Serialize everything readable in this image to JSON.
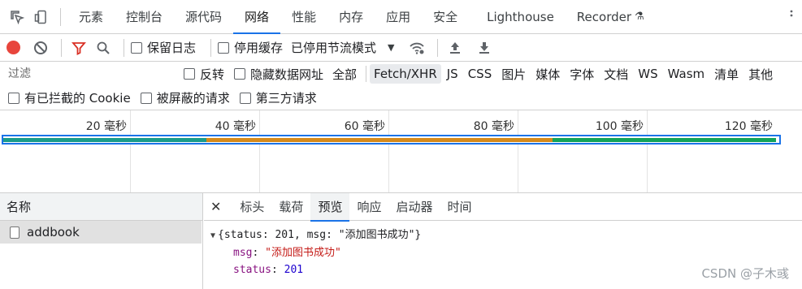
{
  "top_tabs": [
    {
      "label": "元素",
      "active": false
    },
    {
      "label": "控制台",
      "active": false
    },
    {
      "label": "源代码",
      "active": false
    },
    {
      "label": "网络",
      "active": true
    },
    {
      "label": "性能",
      "active": false
    },
    {
      "label": "内存",
      "active": false
    },
    {
      "label": "应用",
      "active": false
    },
    {
      "label": "安全",
      "active": false
    },
    {
      "label": "Lighthouse",
      "active": false
    },
    {
      "label": "Recorder",
      "active": false
    }
  ],
  "toolbar": {
    "preserve_log": "保留日志",
    "disable_cache": "停用缓存",
    "throttle": "已停用节流模式"
  },
  "filter": {
    "placeholder": "过滤",
    "invert": "反转",
    "hide_data_urls": "隐藏数据网址",
    "types": [
      "全部",
      "Fetch/XHR",
      "JS",
      "CSS",
      "图片",
      "媒体",
      "字体",
      "文档",
      "WS",
      "Wasm",
      "清单",
      "其他"
    ],
    "active_type": "Fetch/XHR",
    "blocked_cookies": "有已拦截的 Cookie",
    "blocked_requests": "被屏蔽的请求",
    "third_party": "第三方请求"
  },
  "overview": {
    "ticks": [
      "20 毫秒",
      "40 毫秒",
      "60 毫秒",
      "80 毫秒",
      "100 毫秒",
      "120 毫秒"
    ]
  },
  "names": {
    "header": "名称",
    "rows": [
      "addbook"
    ]
  },
  "detail": {
    "tabs": [
      {
        "label": "标头",
        "active": false
      },
      {
        "label": "载荷",
        "active": false
      },
      {
        "label": "预览",
        "active": true
      },
      {
        "label": "响应",
        "active": false
      },
      {
        "label": "启动器",
        "active": false
      },
      {
        "label": "时间",
        "active": false
      }
    ],
    "preview_summary": "{status: 201, msg: \"添加图书成功\"}",
    "fields": [
      {
        "key": "msg",
        "value": "\"添加图书成功\"",
        "type": "string"
      },
      {
        "key": "status",
        "value": "201",
        "type": "number"
      }
    ]
  },
  "watermark": "CSDN @子木彧",
  "colors": {
    "accent": "#1a73e8",
    "record": "#e8453c",
    "filter_icon": "#d93025",
    "bar_teal": "#1a9c8a",
    "bar_orange": "#d68a1c",
    "bar_green": "#12a35a"
  }
}
